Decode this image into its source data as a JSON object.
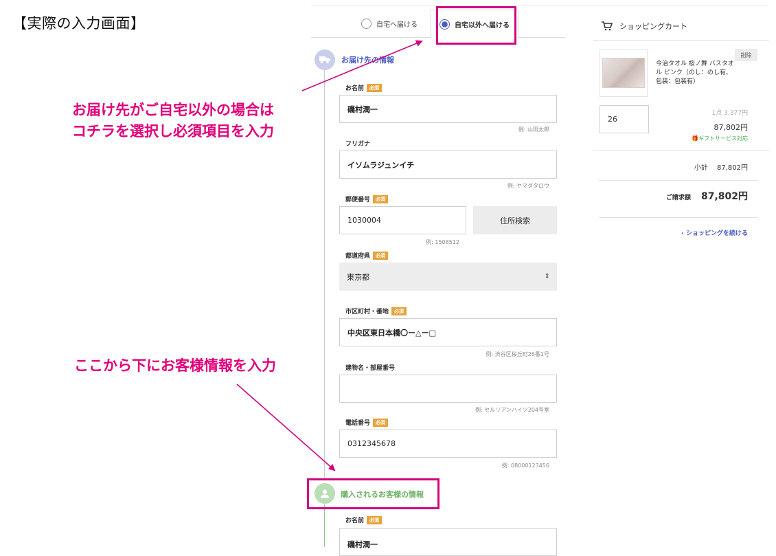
{
  "annotations": {
    "title": "【実際の入力画面】",
    "callout1_line1": "お届け先がご自宅以外の場合は",
    "callout1_line2": "コチラを選択し必須項目を入力",
    "callout2": "ここから下にお客様情報を入力"
  },
  "tabs": {
    "home": "自宅へ届ける",
    "other": "自宅以外へ届ける"
  },
  "delivery": {
    "title": "お届け先の情報",
    "name_label": "お名前",
    "name_value": "磯村潤一",
    "name_hint": "例: 山田太郎",
    "kana_label": "フリガナ",
    "kana_value": "イソムラジュンイチ",
    "kana_hint": "例: ヤマダタロウ",
    "zip_label": "郵便番号",
    "zip_value": "1030004",
    "zip_hint": "例: 1508512",
    "zip_button": "住所検索",
    "pref_label": "都道府県",
    "pref_value": "東京都",
    "city_label": "市区町村・番地",
    "city_value": "中央区東日本橋〇ー△ー□",
    "city_hint": "例: 渋谷区桜丘町26番1号",
    "building_label": "建物名・部屋番号",
    "building_value": "",
    "building_hint": "例: セルリアンハイツ204号室",
    "phone_label": "電話番号",
    "phone_value": "0312345678",
    "phone_hint": "例: 08000123456",
    "required": "必須"
  },
  "customer": {
    "title": "購入されるお客様の情報",
    "name_label": "お名前",
    "name_value": "磯村潤一",
    "required": "必須"
  },
  "cart": {
    "title": "ショッピングカート",
    "delete": "削除",
    "product_name": "今治タオル 桜ノ舞 バスタオル ピンク（のし：のし有、包装：包装有）",
    "quantity": "26",
    "unit_price": "1点 3,377円",
    "line_total": "87,802円",
    "gift": "ギフトサービス対応",
    "subtotal_label": "小計",
    "subtotal_value": "87,802円",
    "total_label": "ご請求額",
    "total_value": "87,802円",
    "continue": "ショッピングを続ける"
  },
  "colors": {
    "annotation_pink": "#e2007a",
    "accent_blue": "#4a5ec4",
    "required_orange": "#e8a33a",
    "customer_green": "#6db567"
  }
}
